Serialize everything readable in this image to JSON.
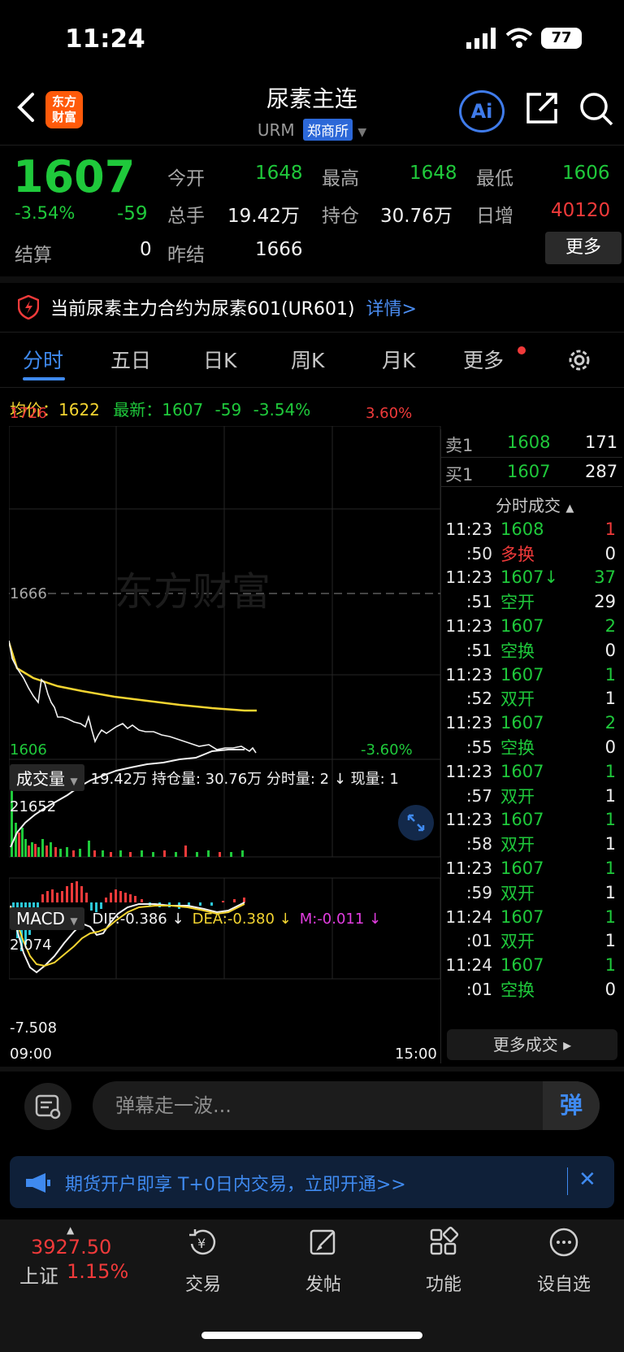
{
  "status": {
    "time": "11:24",
    "battery": "77"
  },
  "header": {
    "logo": "东方\n财富",
    "title": "尿素主连",
    "code": "URM",
    "exchange": "郑商所",
    "ai_label": "Ai"
  },
  "quote": {
    "price": "1607",
    "change_pct": "-3.54%",
    "change": "-59",
    "settle_label": "结算",
    "settle": "0",
    "open_label": "今开",
    "open": "1648",
    "high_label": "最高",
    "high": "1648",
    "low_label": "最低",
    "low": "1606",
    "volume_label": "总手",
    "volume": "19.42万",
    "oi_label": "持仓",
    "oi": "30.76万",
    "oi_change_label": "日增",
    "oi_change": "40120",
    "prev_settle_label": "昨结",
    "prev_settle": "1666",
    "more_label": "更多"
  },
  "notice": {
    "text": "当前尿素主力合约为尿素601(UR601)",
    "link": "详情>"
  },
  "tabs": [
    "分时",
    "五日",
    "日K",
    "周K",
    "月K",
    "更多"
  ],
  "avg": {
    "avg_label": "均价：",
    "avg": "1622",
    "latest_label": "最新：",
    "latest": "1607",
    "chg": "-59",
    "pct": "-3.54%"
  },
  "chart": {
    "y_top": "1726",
    "y_mid": "1666",
    "y_bot": "1606",
    "pct_top": "3.60%",
    "pct_bot": "-3.60%",
    "watermark": "东方财富",
    "vol_label": "成交量",
    "vol_info": "19.42万 持仓量: 30.76万 分时量: 2 ↓ 现量: 1",
    "vol_max": "21652",
    "macd_label": "MACD",
    "dif": "DIF:-0.386 ↓",
    "dea": "DEA:-0.380 ↓",
    "m": "M:-0.011 ↓",
    "macd_top": "2.074",
    "macd_bot": "-7.508",
    "x_start": "09:00",
    "x_end": "15:00"
  },
  "orderbook": {
    "ask_label": "卖1",
    "ask_price": "1608",
    "ask_vol": "171",
    "bid_label": "买1",
    "bid_price": "1607",
    "bid_vol": "287"
  },
  "trades_title": "分时成交",
  "trades": [
    {
      "time": "11:23",
      "price": "1608",
      "vol": "1",
      "pc": "green",
      "vc": "red"
    },
    {
      "time": ":50",
      "price": "多换",
      "vol": "0",
      "pc": "red",
      "vc": "white"
    },
    {
      "time": "11:23",
      "price": "1607↓",
      "vol": "37",
      "pc": "green",
      "vc": "green"
    },
    {
      "time": ":51",
      "price": "空开",
      "vol": "29",
      "pc": "green",
      "vc": "white"
    },
    {
      "time": "11:23",
      "price": "1607",
      "vol": "2",
      "pc": "green",
      "vc": "green"
    },
    {
      "time": ":51",
      "price": "空换",
      "vol": "0",
      "pc": "green",
      "vc": "white"
    },
    {
      "time": "11:23",
      "price": "1607",
      "vol": "1",
      "pc": "green",
      "vc": "green"
    },
    {
      "time": ":52",
      "price": "双开",
      "vol": "1",
      "pc": "green",
      "vc": "white"
    },
    {
      "time": "11:23",
      "price": "1607",
      "vol": "2",
      "pc": "green",
      "vc": "green"
    },
    {
      "time": ":55",
      "price": "空换",
      "vol": "0",
      "pc": "green",
      "vc": "white"
    },
    {
      "time": "11:23",
      "price": "1607",
      "vol": "1",
      "pc": "green",
      "vc": "green"
    },
    {
      "time": ":57",
      "price": "双开",
      "vol": "1",
      "pc": "green",
      "vc": "white"
    },
    {
      "time": "11:23",
      "price": "1607",
      "vol": "1",
      "pc": "green",
      "vc": "green"
    },
    {
      "time": ":58",
      "price": "双开",
      "vol": "1",
      "pc": "green",
      "vc": "white"
    },
    {
      "time": "11:23",
      "price": "1607",
      "vol": "1",
      "pc": "green",
      "vc": "green"
    },
    {
      "time": ":59",
      "price": "双开",
      "vol": "1",
      "pc": "green",
      "vc": "white"
    },
    {
      "time": "11:24",
      "price": "1607",
      "vol": "1",
      "pc": "green",
      "vc": "green"
    },
    {
      "time": ":01",
      "price": "双开",
      "vol": "1",
      "pc": "green",
      "vc": "white"
    },
    {
      "time": "11:24",
      "price": "1607",
      "vol": "1",
      "pc": "green",
      "vc": "green"
    },
    {
      "time": ":01",
      "price": "空换",
      "vol": "0",
      "pc": "green",
      "vc": "white"
    }
  ],
  "more_trades": "更多成交 ▸",
  "danmaku": {
    "placeholder": "弹幕走一波...",
    "send": "弹"
  },
  "ad": {
    "text": "期货开户即享 T+0日内交易，立即开通>>",
    "close": "✕"
  },
  "nav": {
    "index_value": "3927.50",
    "index_name": "上证",
    "index_pct": "1.15%",
    "items": [
      "交易",
      "发帖",
      "功能",
      "设自选"
    ]
  },
  "colors": {
    "up": "#f03a3a",
    "down": "#1fc93b",
    "accent": "#3f8af0",
    "avg_line": "#f3d431"
  }
}
